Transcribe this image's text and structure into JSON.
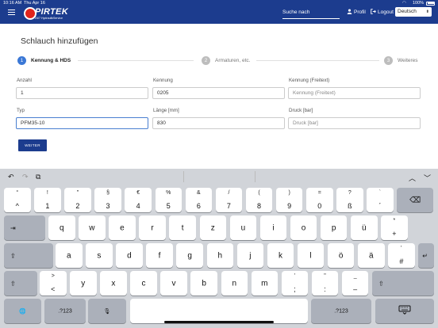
{
  "status_bar": {
    "time": "10:16 AM",
    "date": "Thu Apr 16",
    "battery": "100%"
  },
  "header": {
    "logo_text": "PIRTEK",
    "logo_sub": "24/7 HydraulikService",
    "search_placeholder": "Suche nach",
    "profile_label": "Profil",
    "logout_label": "Logout",
    "language": "Deutsch",
    "brand_color": "#1c3c8e"
  },
  "page": {
    "title": "Schlauch hinzufügen",
    "steps": [
      {
        "num": "1",
        "label": "Kennung & HDS"
      },
      {
        "num": "2",
        "label": "Armaturen, etc."
      },
      {
        "num": "3",
        "label": "Weiteres"
      }
    ],
    "fields": {
      "anzahl": {
        "label": "Anzahl",
        "value": "1",
        "placeholder": ""
      },
      "kennung": {
        "label": "Kennung",
        "value": "0205",
        "placeholder": ""
      },
      "kennung_freitext": {
        "label": "Kennung (Freitext)",
        "value": "",
        "placeholder": "Kennung (Freitext)"
      },
      "typ": {
        "label": "Typ",
        "value": "PFM35-10",
        "placeholder": ""
      },
      "laenge": {
        "label": "Länge [mm]",
        "value": "830",
        "placeholder": ""
      },
      "druck": {
        "label": "Druck [bar]",
        "value": "",
        "placeholder": "Druck [bar]"
      }
    },
    "next_button": "WEITER"
  },
  "keyboard": {
    "toolbar": {
      "undo": "↶",
      "redo": "↷",
      "paste": "⧉",
      "up": "︿",
      "down": "﹀"
    },
    "row1": [
      {
        "top": "°",
        "bot": "^"
      },
      {
        "top": "!",
        "bot": "1"
      },
      {
        "top": "\"",
        "bot": "2"
      },
      {
        "top": "§",
        "bot": "3"
      },
      {
        "top": "€",
        "bot": "4"
      },
      {
        "top": "%",
        "bot": "5"
      },
      {
        "top": "&",
        "bot": "6"
      },
      {
        "top": "/",
        "bot": "7"
      },
      {
        "top": "(",
        "bot": "8"
      },
      {
        "top": ")",
        "bot": "9"
      },
      {
        "top": "=",
        "bot": "0"
      },
      {
        "top": "?",
        "bot": "ß"
      },
      {
        "top": "`",
        "bot": "´"
      }
    ],
    "row2": [
      "q",
      "w",
      "e",
      "r",
      "t",
      "z",
      "u",
      "i",
      "o",
      "p",
      "ü"
    ],
    "row2_extra": {
      "top": "*",
      "bot": "+"
    },
    "row3": [
      "a",
      "s",
      "d",
      "f",
      "g",
      "h",
      "j",
      "k",
      "l",
      "ö",
      "ä"
    ],
    "row3_extra": {
      "top": "'",
      "bot": "#"
    },
    "row4_first": {
      "top": ">",
      "bot": "<"
    },
    "row4": [
      "y",
      "x",
      "c",
      "v",
      "b",
      "n",
      "m"
    ],
    "row4_punct": [
      {
        "top": "'",
        "bot": ";"
      },
      {
        "top": "\"",
        "bot": ":"
      },
      {
        "top": "_",
        "bot": "–"
      }
    ],
    "symbols_label": ".?123",
    "backspace": "⌫",
    "tab": "⇥",
    "caps": "⇪",
    "shift": "⇧",
    "return": "↵",
    "globe": "🌐",
    "mic": "🎙"
  }
}
